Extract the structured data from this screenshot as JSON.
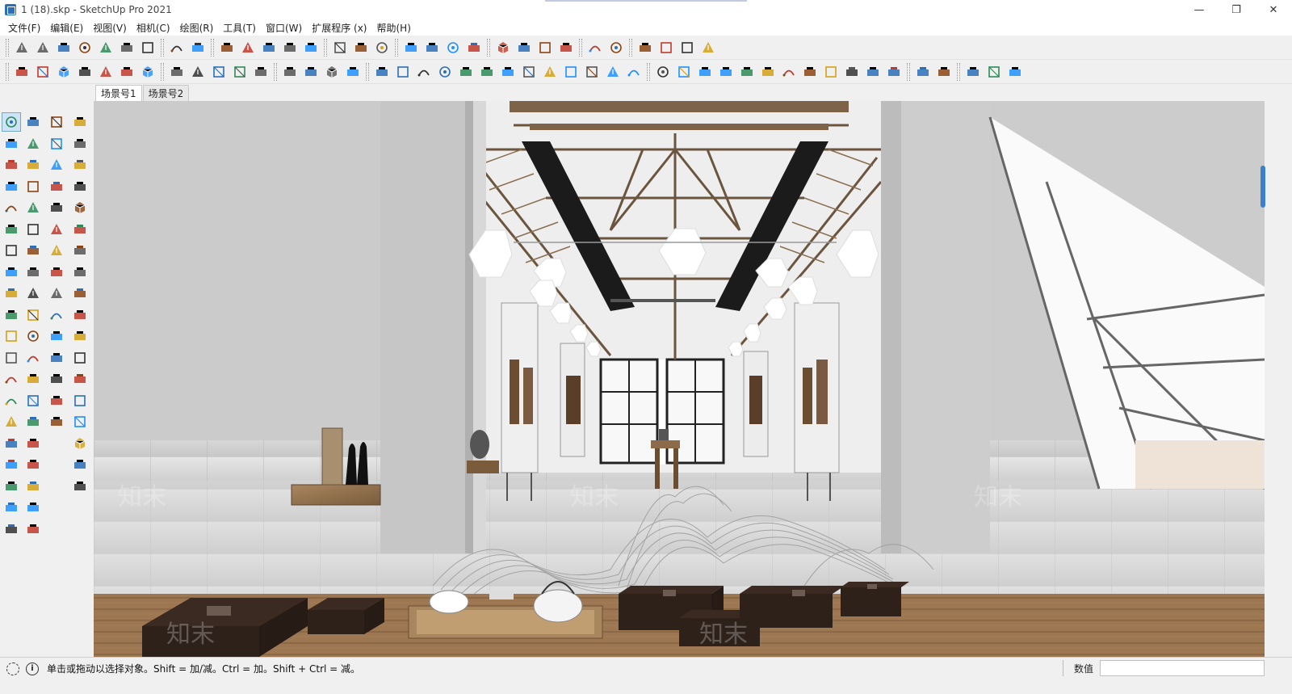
{
  "window": {
    "title": "1 (18).skp - SketchUp Pro 2021",
    "controls": [
      "minimize",
      "restore",
      "close"
    ],
    "minimize_glyph": "—",
    "restore_glyph": "❐",
    "close_glyph": "✕"
  },
  "menubar": {
    "items": [
      "文件(F)",
      "编辑(E)",
      "视图(V)",
      "相机(C)",
      "绘图(R)",
      "工具(T)",
      "窗口(W)",
      "扩展程序 (x)",
      "帮助(H)"
    ]
  },
  "toolbar_row1": {
    "icons": [
      "getting-started-icon",
      "select-box-icon",
      "component-icon",
      "paint-icon",
      "eraser-icon",
      "layers-icon",
      "sections-icon",
      "section-plane-icon",
      "group-icon",
      "outliner-icon",
      "warehouse-icon",
      "extension-warehouse-icon",
      "layout-icon",
      "style-builder-icon",
      "xray-icon",
      "back-edges-icon",
      "wireframe-icon",
      "hidden-line-icon",
      "shaded-icon",
      "textured-icon",
      "monochrome-icon",
      "teapot-icon",
      "hand-icon",
      "rotate-orbit-icon",
      "refresh-icon",
      "text-icon",
      "dimension-icon",
      "window-icon",
      "window-2-icon",
      "window-3-icon",
      "lock-icon"
    ]
  },
  "toolbar_row2": {
    "icons": [
      "iso-view-icon",
      "top-view-icon",
      "front-view-icon",
      "right-view-icon",
      "back-view-icon",
      "left-view-icon",
      "bottom-view-icon",
      "house-icon",
      "door-icon",
      "home-icon",
      "roof-icon",
      "awning-icon",
      "stairs-icon",
      "columns-icon",
      "ramp-icon",
      "steps-icon",
      "move-axis-icon",
      "align-icon",
      "curve-tool-icon",
      "bezier-icon",
      "arc-icon",
      "loop-icon",
      "spiral-icon",
      "slab-icon",
      "pen-icon",
      "fold-icon",
      "shell-icon",
      "book-icon",
      "arrow-path-icon",
      "arch-icon",
      "wave-icon",
      "bend-icon",
      "target-icon",
      "brush-icon",
      "fence-icon",
      "colonnade-icon",
      "triangle-icon",
      "grid-dots-icon",
      "panel-icon",
      "pin-icon",
      "broom-icon",
      "model-1-icon",
      "model-2-icon",
      "frame-icon",
      "frame-2-icon",
      "model-3-icon"
    ]
  },
  "scene_tabs": [
    {
      "label": "场景号1",
      "active": true
    },
    {
      "label": "场景号2",
      "active": false
    }
  ],
  "left_tools": {
    "col1": [
      "select-icon",
      "paint-bucket-icon",
      "pencil-icon",
      "rectangle-icon",
      "circle-icon",
      "arc-icon",
      "pie-icon",
      "move-icon",
      "rotate-icon",
      "scale-icon",
      "tape-measure-icon",
      "protractor-icon",
      "axes-icon",
      "orbit-icon",
      "zoom-icon",
      "zoom-extents-icon",
      "walk-icon",
      "footprints-icon",
      "sandbox-icon",
      "sandbox-2-icon"
    ],
    "col2": [
      "component-icon",
      "eraser-icon",
      "freehand-icon",
      "rotated-rect-icon",
      "polygon-icon",
      "two-point-arc-icon",
      "three-point-arc-icon",
      "push-pull-icon",
      "follow-me-icon",
      "offset-icon",
      "dimension-icon",
      "text-icon",
      "3d-text-icon",
      "pan-icon",
      "zoom-window-icon",
      "previous-view-icon",
      "look-around-icon",
      "position-camera-icon",
      "smoove-icon",
      "stamp-icon"
    ],
    "col3": [
      "outer-shell-icon",
      "intersect-icon",
      "paint-faces-icon",
      "box-icon",
      "cylinder-icon",
      "sphere-icon",
      "cone-icon",
      "camera-icon",
      "camera-2-icon",
      "torus-icon",
      "triangle-ruler-icon",
      "table-tool-icon",
      "sun-icon",
      "helmet-icon",
      "shadow-icon"
    ],
    "col4": [
      "chain-icon",
      "cloud-link-icon",
      "cloud-sync-icon",
      "cloud-list-icon",
      "window-frame-icon",
      "dots-circle-icon",
      "refresh-circle-icon",
      "pyramid-icon",
      "cycle-icon",
      "video-icon",
      "add-icon",
      "tree-icon",
      "fan-icon",
      "checker-icon",
      "upload-cloud-icon",
      "settings-icon",
      "mail-icon",
      "info-icon"
    ]
  },
  "statusbar": {
    "info_glyph": "i",
    "hint": "单击或拖动以选择对象。Shift = 加/减。Ctrl = 加。Shift + Ctrl = 减。",
    "measure_label": "数值",
    "measure_value": ""
  },
  "viewport": {
    "scene": "gallery interior render",
    "watermark": "知末"
  }
}
